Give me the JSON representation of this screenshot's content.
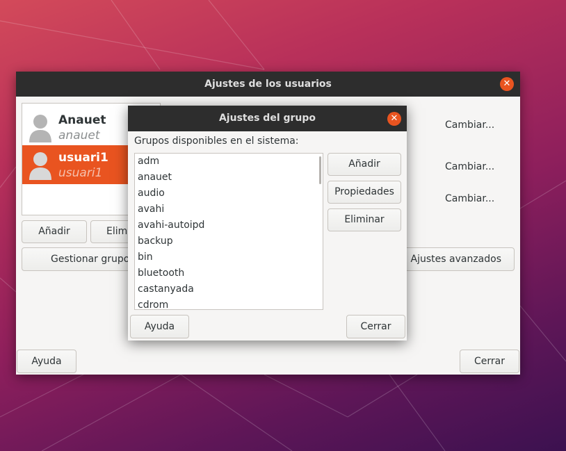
{
  "main_window": {
    "title": "Ajustes de los usuarios",
    "users": [
      {
        "name": "Anauet",
        "login": "anauet",
        "selected": false
      },
      {
        "name": "usuari1",
        "login": "usuari1",
        "selected": true
      }
    ],
    "add_label": "Añadir",
    "delete_label_partial": "Elimi",
    "manage_groups_label": "Gestionar grupos",
    "change_labels": [
      "Cambiar...",
      "Cambiar...",
      "Cambiar..."
    ],
    "advanced_label": "Ajustes avanzados",
    "help_label": "Ayuda",
    "close_label": "Cerrar"
  },
  "group_dialog": {
    "title": "Ajustes del grupo",
    "available_label": "Grupos disponibles en el sistema:",
    "groups": [
      "adm",
      "anauet",
      "audio",
      "avahi",
      "avahi-autoipd",
      "backup",
      "bin",
      "bluetooth",
      "castanyada",
      "cdrom"
    ],
    "add_label": "Añadir",
    "properties_label": "Propiedades",
    "delete_label": "Eliminar",
    "help_label": "Ayuda",
    "close_label": "Cerrar"
  },
  "colors": {
    "accent": "#e95420",
    "titlebar": "#2d2d2d",
    "window_bg": "#f6f5f4"
  },
  "icons": {
    "close": "close-icon",
    "avatar": "user-avatar-icon"
  }
}
